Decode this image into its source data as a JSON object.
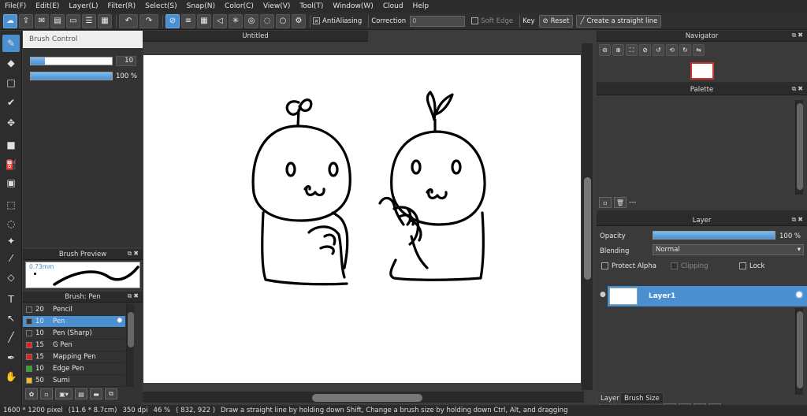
{
  "menu": [
    "File(F)",
    "Edit(E)",
    "Layer(L)",
    "Filter(R)",
    "Select(S)",
    "Snap(N)",
    "Color(C)",
    "View(V)",
    "Tool(T)",
    "Window(W)",
    "Cloud",
    "Help"
  ],
  "toolbar": {
    "antialiasing_label": "AntiAliasing",
    "antialiasing_checked": "×",
    "correction_label": "Correction",
    "correction_value": "0",
    "soft_edge_label": "Soft Edge",
    "key_label": "Key",
    "reset_label": "Reset",
    "straight_line_label": "Create a straight line"
  },
  "brush_control": {
    "title": "Brush Control",
    "size_value": "10",
    "size_fraction": 0.17,
    "opacity_value": "100 %",
    "opacity_fraction": 1.0
  },
  "brush_preview": {
    "title": "Brush Preview",
    "size_text": "0.73mm"
  },
  "brush_list": {
    "title": "Brush: Pen",
    "items": [
      {
        "size": "20",
        "name": "Pencil",
        "color": "#333333",
        "selected": false
      },
      {
        "size": "10",
        "name": "Pen",
        "color": "#333333",
        "selected": true
      },
      {
        "size": "10",
        "name": "Pen (Sharp)",
        "color": "#333333",
        "selected": false
      },
      {
        "size": "15",
        "name": "G Pen",
        "color": "#e02020",
        "selected": false
      },
      {
        "size": "15",
        "name": "Mapping Pen",
        "color": "#e02020",
        "selected": false
      },
      {
        "size": "10",
        "name": "Edge Pen",
        "color": "#20b020",
        "selected": false
      },
      {
        "size": "50",
        "name": "Sumi",
        "color": "#f0c020",
        "selected": false
      }
    ]
  },
  "canvas": {
    "doc_title": "Untitled"
  },
  "navigator": {
    "title": "Navigator"
  },
  "palette": {
    "title": "Palette",
    "footer_text": "---"
  },
  "layer": {
    "title": "Layer",
    "opacity_label": "Opacity",
    "opacity_value": "100 %",
    "opacity_fraction": 1.0,
    "blending_label": "Blending",
    "blending_value": "Normal",
    "protect_alpha_label": "Protect Alpha",
    "clipping_label": "Clipping",
    "lock_label": "Lock",
    "layers": [
      {
        "name": "Layer1"
      }
    ],
    "tabs": [
      "Layer",
      "Brush Size"
    ]
  },
  "status": {
    "dimensions": "1600 * 1200 pixel",
    "physical": "(11.6 * 8.7cm)",
    "dpi": "350 dpi",
    "zoom": "46 %",
    "cursor": "( 832, 922 )",
    "hint": "Draw a straight line by holding down Shift, Change a brush size by holding down Ctrl, Alt, and dragging"
  },
  "colors": {
    "accent": "#4a90d0",
    "panel_bg": "#3a3a3a",
    "header_bg": "#2b2b2b"
  }
}
